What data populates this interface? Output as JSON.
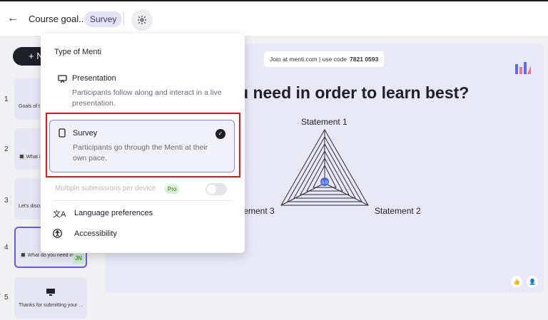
{
  "header": {
    "title": "Course goal...",
    "badge": "Survey"
  },
  "new_button_label": "+ N",
  "slides": [
    {
      "number": "1",
      "label": "Goals of t"
    },
    {
      "number": "2",
      "label": "🔳 What i"
    },
    {
      "number": "3",
      "label": "Let's discu"
    },
    {
      "number": "4",
      "label": "🔳 What do you need in",
      "avatar": "JN"
    },
    {
      "number": "5",
      "label": "Thanks for submitting your ..."
    }
  ],
  "canvas": {
    "join_text": "Join at menti.com | use code",
    "join_code": "7821 0593",
    "question": "u need in order to learn best?",
    "statement_top": "Statement 1",
    "statement_right": "Statement 2",
    "statement_left": "tement 3",
    "center_value": "0.0"
  },
  "settings_popover": {
    "heading": "Type of Menti",
    "options": [
      {
        "title": "Presentation",
        "description": "Participants follow along and interact in a live presentation.",
        "selected": false
      },
      {
        "title": "Survey",
        "description": "Participants go through the Menti at their own pace.",
        "selected": true
      }
    ],
    "multiple_submissions_label": "Multiple submissions per device",
    "pro_badge": "Pro",
    "menu": [
      {
        "label": "Language preferences",
        "icon": "translate-icon"
      },
      {
        "label": "Accessibility",
        "icon": "accessibility-icon"
      }
    ]
  },
  "colors": {
    "accent_purple": "#6b5bd8",
    "highlight_red": "#e01818",
    "dark": "#1f1f2a"
  }
}
